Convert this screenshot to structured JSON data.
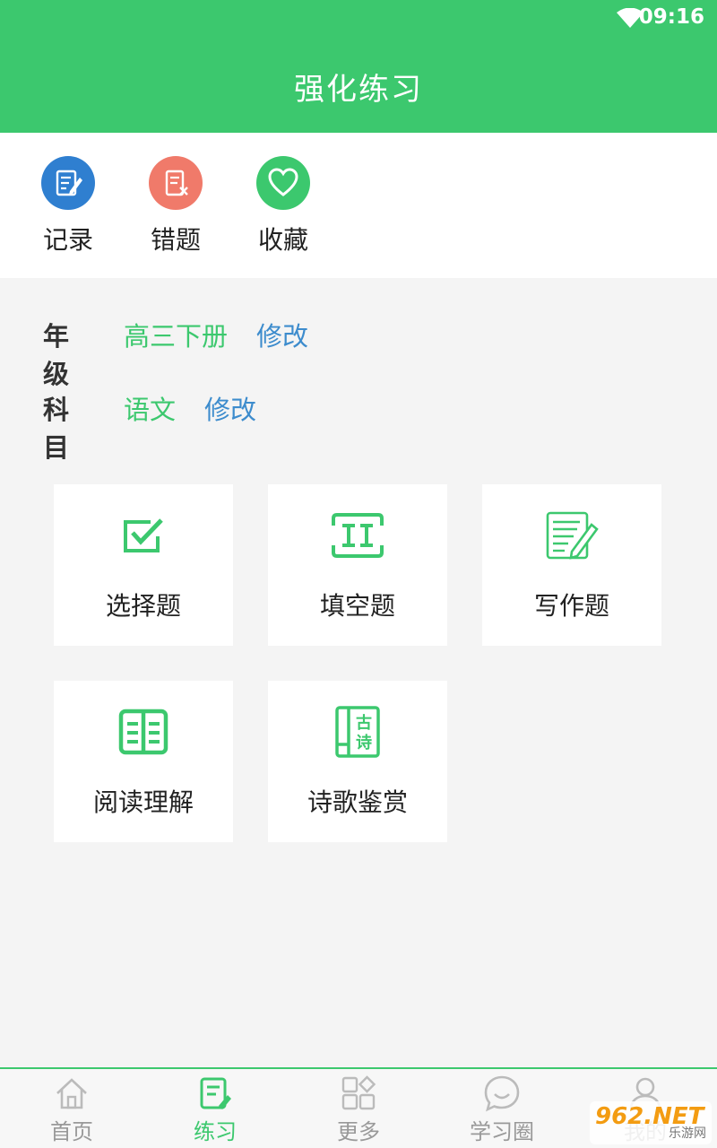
{
  "status_bar": {
    "time": "09:16",
    "wifi_icon": "wifi-icon"
  },
  "header": {
    "title": "强化练习"
  },
  "quick_actions": [
    {
      "label": "记录",
      "icon": "record-icon",
      "color": "#2f7fd0"
    },
    {
      "label": "错题",
      "icon": "wrong-question-icon",
      "color": "#f07a6a"
    },
    {
      "label": "收藏",
      "icon": "heart-icon",
      "color": "#3cc86e"
    }
  ],
  "settings": {
    "grade": {
      "label": "年级",
      "value": "高三下册",
      "edit": "修改"
    },
    "subject": {
      "label": "科目",
      "value": "语文",
      "edit": "修改"
    }
  },
  "exercise_types": [
    {
      "label": "选择题",
      "icon": "checkbox-icon"
    },
    {
      "label": "填空题",
      "icon": "fill-blank-icon"
    },
    {
      "label": "写作题",
      "icon": "writing-icon"
    },
    {
      "label": "阅读理解",
      "icon": "book-icon"
    },
    {
      "label": "诗歌鉴赏",
      "icon": "poem-icon",
      "icon_text": [
        "古",
        "诗"
      ]
    }
  ],
  "tabs": [
    {
      "label": "首页",
      "icon": "home-icon",
      "active": false
    },
    {
      "label": "练习",
      "icon": "practice-icon",
      "active": true
    },
    {
      "label": "更多",
      "icon": "more-grid-icon",
      "active": false
    },
    {
      "label": "学习圈",
      "icon": "chat-circle-icon",
      "active": false
    },
    {
      "label": "我的",
      "icon": "user-icon",
      "active": false
    }
  ],
  "watermark": {
    "text": "962.NET",
    "sub": "乐游网"
  },
  "colors": {
    "primary": "#3cc86e",
    "link": "#3d8ccd",
    "background": "#f4f4f4"
  }
}
